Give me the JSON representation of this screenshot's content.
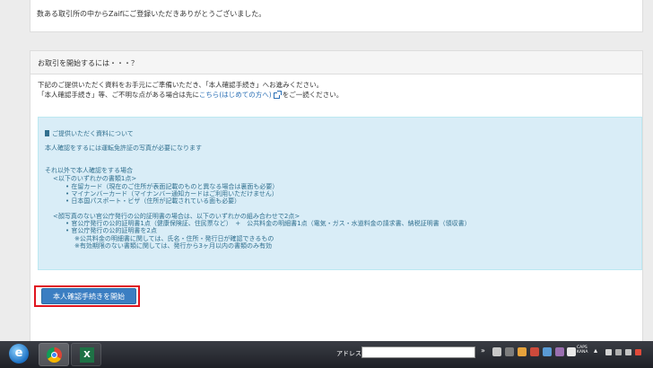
{
  "top_panel": {
    "message": "数ある取引所の中からZaifにご登録いただきありがとうございました。"
  },
  "main_panel": {
    "heading": "お取引を開始するには・・・？",
    "intro_line1": "下記のご提供いただく資料をお手元にご準備いただき、「本人確認手続き」へお進みください。",
    "intro_line2_before": "「本人確認手続き」等、ご不明な点がある場合は先に",
    "intro_link": "こちら(はじめての方へ)",
    "intro_line2_after": "をご一読ください。",
    "info_box": {
      "title": "ご提供いただく資料について",
      "line1": "本人確認をするには運転免許証の写真が必要になります",
      "line2": "それ以外で本人確認をする場合",
      "line3": "<以下のいずれかの書類1点>",
      "bullets_a": [
        "在留カード（現在のご住所が表面記載のものと異なる場合は裏面も必要）",
        "マイナンバーカード（マイナンバー通知カードはご利用いただけません）",
        "日本国パスポート・ビザ（住所が記載されている面も必要）"
      ],
      "line4": "<顔写真のない官公庁発行の公的証明書の場合は、以下のいずれかの組み合わせで2点>",
      "bullets_b": [
        "官公庁発行の公的証明書1点（健康保険証、住民票など）　+　公共料金の明細書1点（電気・ガス・水道料金の請求書、納税証明書（領収書）",
        "官公庁発行の公的証明書を2点"
      ],
      "notes": [
        "※公共料金の明細書に関しては、氏名・住所・発行日が確認できるもの",
        "※有効期限のない書類に関しては、発行から3ヶ月以内の書類のみ有効"
      ]
    },
    "start_button_label": "本人確認手続きを開始"
  },
  "taskbar": {
    "address_label": "アドレス",
    "address_value": "",
    "caps_line1": "CAPS",
    "caps_line2": "KANA",
    "accent": "#2b2e35"
  },
  "colors": {
    "info_bg": "#d9edf7",
    "info_text": "#31708f",
    "primary_button": "#3b7ec2",
    "highlight_outline": "#e0141e",
    "link": "#2a6fb5"
  }
}
